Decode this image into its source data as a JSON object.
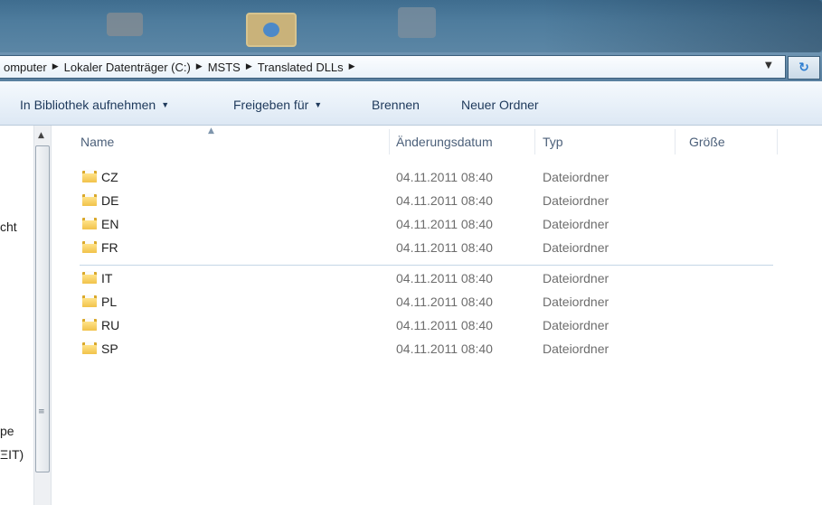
{
  "address": {
    "crumbs": [
      "omputer",
      "Lokaler Datenträger (C:)",
      "MSTS",
      "Translated DLLs"
    ]
  },
  "toolbar": {
    "library_label": "In Bibliothek aufnehmen",
    "share_label": "Freigeben für",
    "burn_label": "Brennen",
    "new_folder_label": "Neuer Ordner"
  },
  "navpane": {
    "items": [
      "cht",
      "pe",
      "ΞIT)"
    ]
  },
  "columns": {
    "name": "Name",
    "date": "Änderungsdatum",
    "type": "Typ",
    "size": "Größe"
  },
  "files": [
    {
      "name": "CZ",
      "date": "04.11.2011 08:40",
      "type": "Dateiordner"
    },
    {
      "name": "DE",
      "date": "04.11.2011 08:40",
      "type": "Dateiordner"
    },
    {
      "name": "EN",
      "date": "04.11.2011 08:40",
      "type": "Dateiordner"
    },
    {
      "name": "FR",
      "date": "04.11.2011 08:40",
      "type": "Dateiordner"
    },
    {
      "name": "IT",
      "date": "04.11.2011 08:40",
      "type": "Dateiordner"
    },
    {
      "name": "PL",
      "date": "04.11.2011 08:40",
      "type": "Dateiordner"
    },
    {
      "name": "RU",
      "date": "04.11.2011 08:40",
      "type": "Dateiordner"
    },
    {
      "name": "SP",
      "date": "04.11.2011 08:40",
      "type": "Dateiordner"
    }
  ],
  "icons": {
    "folder": "folder-icon",
    "breadcrumb_separator": "chevron-right-icon",
    "refresh": "refresh-icon"
  }
}
